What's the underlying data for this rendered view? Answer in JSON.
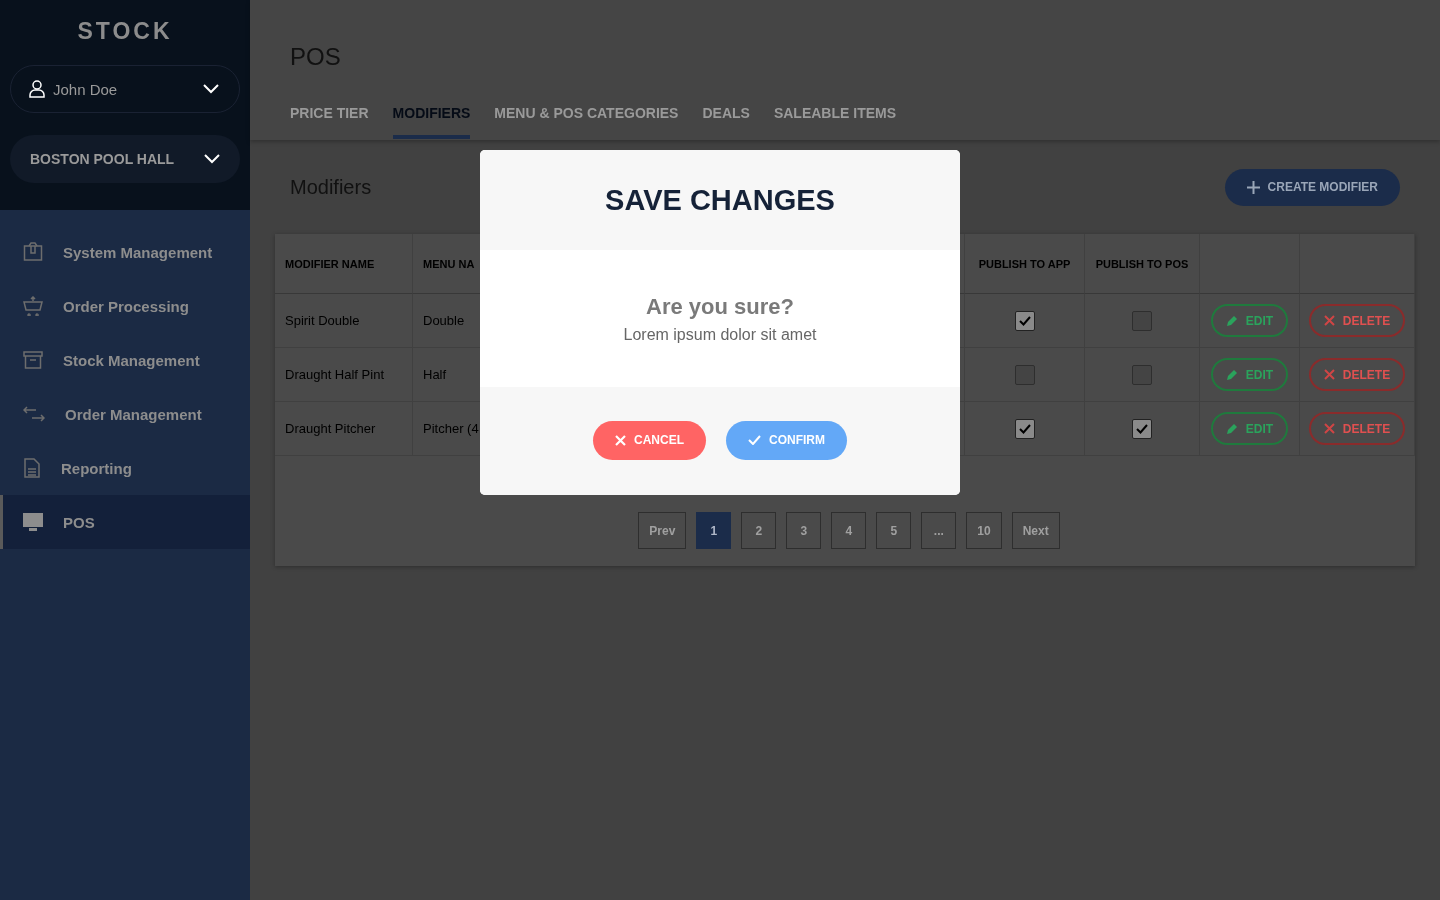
{
  "sidebar": {
    "logo": "STOCK",
    "user": "John Doe",
    "venue": "BOSTON POOL HALL",
    "items": [
      {
        "label": "System Management",
        "selected": false
      },
      {
        "label": "Order Processing",
        "selected": false
      },
      {
        "label": "Stock Management",
        "selected": false
      },
      {
        "label": "Order Management",
        "selected": false
      },
      {
        "label": "Reporting",
        "selected": false
      },
      {
        "label": "POS",
        "selected": true
      }
    ]
  },
  "page_title": "POS",
  "tabs": [
    {
      "label": "PRICE TIER",
      "selected": false
    },
    {
      "label": "MODIFIERS",
      "selected": true
    },
    {
      "label": "MENU & POS CATEGORIES",
      "selected": false
    },
    {
      "label": "DEALS",
      "selected": false
    },
    {
      "label": "SALEABLE ITEMS",
      "selected": false
    }
  ],
  "section_title": "Modifiers",
  "create_button": "CREATE MODIFIER",
  "table": {
    "columns": [
      "MODIFIER NAME",
      "MENU NA",
      "PUBLISH TO APP",
      "PUBLISH TO POS"
    ],
    "rows": [
      {
        "name": "Spirit Double",
        "menu_name": "Double",
        "publish_to_app": true,
        "publish_to_pos": false,
        "edit": "EDIT",
        "delete": "DELETE"
      },
      {
        "name": "Draught Half Pint",
        "menu_name": "Half",
        "publish_to_app": false,
        "publish_to_pos": false,
        "edit": "EDIT",
        "delete": "DELETE"
      },
      {
        "name": "Draught Pitcher",
        "menu_name": "Pitcher (4",
        "publish_to_app": true,
        "publish_to_pos": true,
        "edit": "EDIT",
        "delete": "DELETE"
      }
    ]
  },
  "pagination": [
    {
      "label": "Prev",
      "selected": false
    },
    {
      "label": "1",
      "selected": true
    },
    {
      "label": "2",
      "selected": false
    },
    {
      "label": "3",
      "selected": false
    },
    {
      "label": "4",
      "selected": false
    },
    {
      "label": "5",
      "selected": false
    },
    {
      "label": "...",
      "selected": false
    },
    {
      "label": "10",
      "selected": false
    },
    {
      "label": "Next",
      "selected": false
    }
  ],
  "dialog": {
    "title": "SAVE CHANGES",
    "question": "Are you sure?",
    "message": "Lorem ipsum dolor sit amet",
    "cancel": "CANCEL",
    "confirm": "CONFIRM"
  }
}
